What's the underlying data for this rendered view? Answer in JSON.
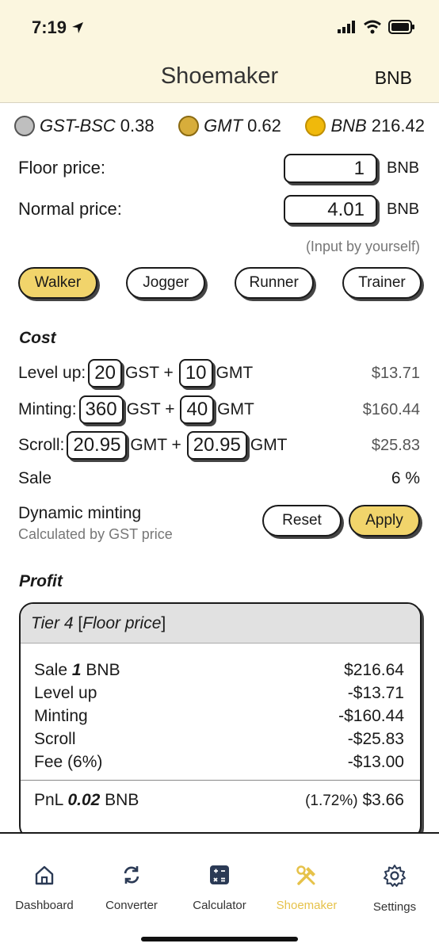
{
  "status": {
    "time": "7:19"
  },
  "header": {
    "title": "Shoemaker",
    "right": "BNB"
  },
  "ticker": [
    {
      "name": "GST-BSC",
      "value": "0.38",
      "icon": "gst-coin-icon"
    },
    {
      "name": "GMT",
      "value": "0.62",
      "icon": "gmt-coin-icon"
    },
    {
      "name": "BNB",
      "value": "216.42",
      "icon": "bnb-coin-icon"
    }
  ],
  "prices": {
    "floor": {
      "label": "Floor price:",
      "value": "1",
      "unit": "BNB"
    },
    "normal": {
      "label": "Normal price:",
      "value": "4.01",
      "unit": "BNB"
    },
    "hint": "(Input by yourself)"
  },
  "segments": [
    "Walker",
    "Jogger",
    "Runner",
    "Trainer"
  ],
  "cost": {
    "title": "Cost",
    "level_up": {
      "label": "Level up:",
      "a": "20",
      "a_unit": "GST +",
      "b": "10",
      "b_unit": "GMT",
      "value": "$13.71"
    },
    "minting": {
      "label": "Minting:",
      "a": "360",
      "a_unit": "GST +",
      "b": "40",
      "b_unit": "GMT",
      "value": "$160.44"
    },
    "scroll": {
      "label": "Scroll:",
      "a": "20.95",
      "a_unit": "GMT +",
      "b": "20.95",
      "b_unit": "GMT",
      "value": "$25.83"
    },
    "sale": {
      "label": "Sale",
      "value": "6 %"
    }
  },
  "dynamic": {
    "title": "Dynamic minting",
    "subtitle": "Calculated by GST price",
    "reset": "Reset",
    "apply": "Apply"
  },
  "profit": {
    "title": "Profit",
    "card_title_tier": "Tier 4",
    "card_title_open": "[",
    "card_title_price": "Floor price",
    "card_title_close": "]",
    "sale_prefix": "Sale",
    "sale_amount": "1",
    "sale_unit": "BNB",
    "sale_value": "$216.64",
    "lines": [
      {
        "label": "Level up",
        "value": "-$13.71"
      },
      {
        "label": "Minting",
        "value": "-$160.44"
      },
      {
        "label": "Scroll",
        "value": "-$25.83"
      },
      {
        "label": "Fee (6%)",
        "value": "-$13.00"
      }
    ],
    "pnl_prefix": "PnL",
    "pnl_amount": "0.02",
    "pnl_unit": "BNB",
    "pnl_pct": "(1.72%)",
    "pnl_value": "$3.66"
  },
  "tabs": [
    {
      "label": "Dashboard",
      "icon": "home-icon"
    },
    {
      "label": "Converter",
      "icon": "refresh-icon"
    },
    {
      "label": "Calculator",
      "icon": "calculator-icon"
    },
    {
      "label": "Shoemaker",
      "icon": "tools-icon",
      "active": true
    },
    {
      "label": "Settings",
      "icon": "gear-icon"
    }
  ],
  "colors": {
    "accent": "#f1d46b",
    "header_bg": "#fbf6df",
    "active_tab": "#e6c24a"
  }
}
